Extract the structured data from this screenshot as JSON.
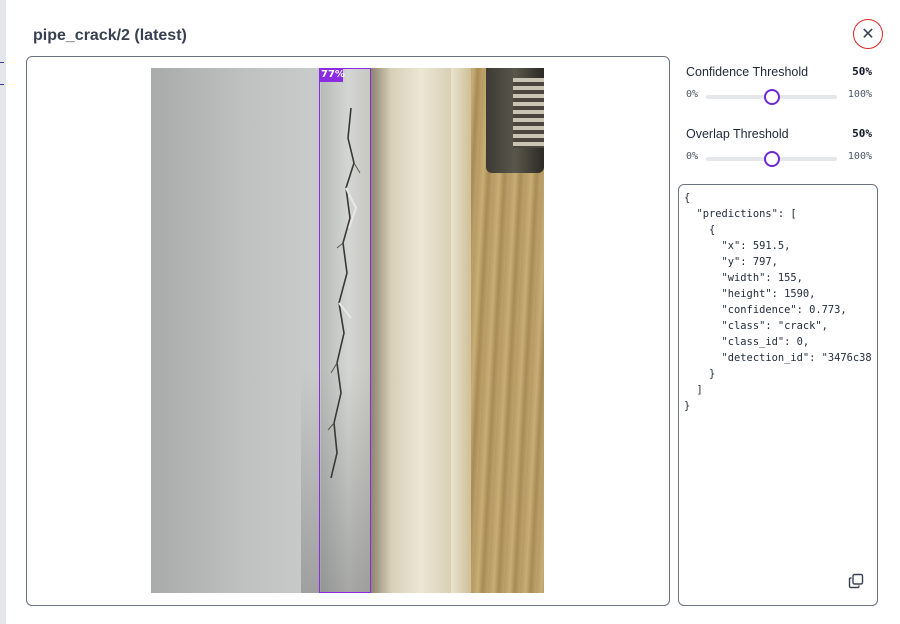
{
  "modal": {
    "title": "pipe_crack/2 (latest)",
    "close_icon": "close-icon"
  },
  "detection": {
    "label": "77%",
    "color": "#8b2be2"
  },
  "controls": {
    "confidence": {
      "label": "Confidence Threshold",
      "value": "50%",
      "min": "0%",
      "max": "100%",
      "level": 0.5
    },
    "overlap": {
      "label": "Overlap Threshold",
      "value": "50%",
      "min": "0%",
      "max": "100%",
      "level": 0.5
    },
    "accent": "#6d28d9"
  },
  "output": {
    "json_text": "{\n  \"predictions\": [\n    {\n      \"x\": 591.5,\n      \"y\": 797,\n      \"width\": 155,\n      \"height\": 1590,\n      \"confidence\": 0.773,\n      \"class\": \"crack\",\n      \"class_id\": 0,\n      \"detection_id\": \"3476c38\n    }\n  ]\n}",
    "copy_icon": "copy-icon"
  }
}
